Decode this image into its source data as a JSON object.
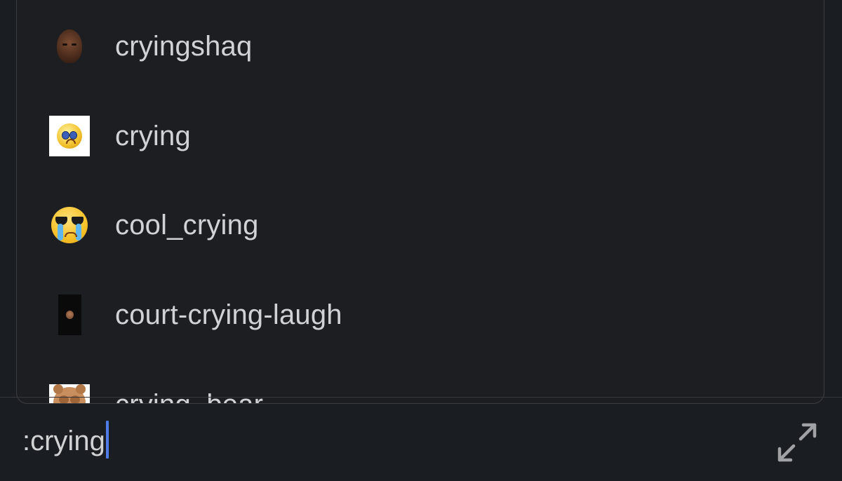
{
  "emoji_suggestions": {
    "items": [
      {
        "name": "cryingshaq",
        "icon": "crying-shaq-icon"
      },
      {
        "name": "crying",
        "icon": "crying-face-icon"
      },
      {
        "name": "cool_crying",
        "icon": "cool-crying-face-icon"
      },
      {
        "name": "court-crying-laugh",
        "icon": "court-crying-laugh-icon"
      },
      {
        "name": "crying_bear",
        "icon": "crying-bear-icon"
      }
    ]
  },
  "composer": {
    "input_value": ":crying",
    "expand_icon": "expand-arrows-icon",
    "caret_color": "#4f7de8"
  },
  "colors": {
    "background": "#1a1d21",
    "popup_background": "#1d1e22",
    "text": "#d1d2d3",
    "icon": "#a0a2a6"
  }
}
